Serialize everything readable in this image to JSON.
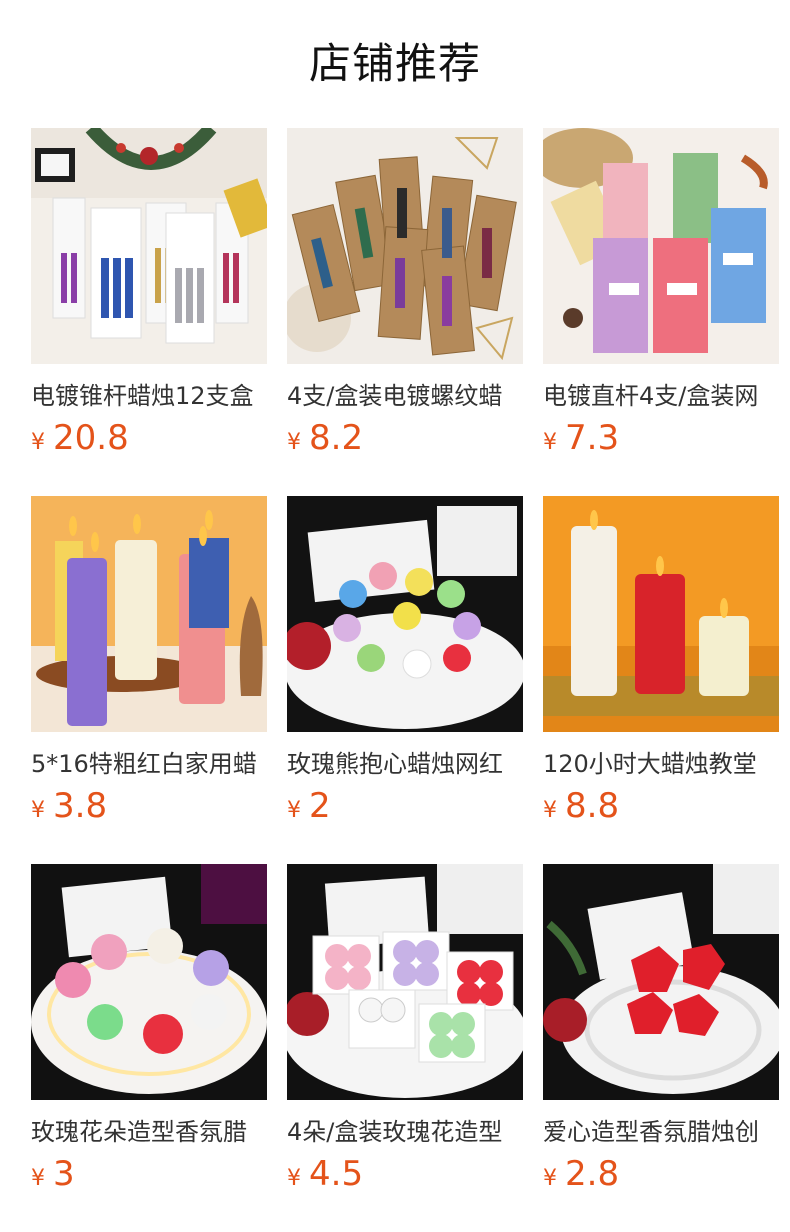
{
  "header": {
    "title": "店铺推荐"
  },
  "currency_symbol": "¥",
  "colors": {
    "price": "#e4531a",
    "text": "#333333"
  },
  "products": [
    {
      "name": "电镀锥杆蜡烛12支盒",
      "price": "20.8",
      "image": "gift-box-taper-candles"
    },
    {
      "name": "4支/盒装电镀螺纹蜡",
      "price": "8.2",
      "image": "kraft-box-spiral-candles"
    },
    {
      "name": "电镀直杆4支/盒装网",
      "price": "7.3",
      "image": "classic-pack-taper-candles"
    },
    {
      "name": "5*16特粗红白家用蜡",
      "price": "3.8",
      "image": "pillar-candles-colorful"
    },
    {
      "name": "玫瑰熊抱心蜡烛网红",
      "price": "2",
      "image": "teddy-bear-candles"
    },
    {
      "name": "120小时大蜡烛教堂",
      "price": "8.8",
      "image": "large-church-pillar-candles"
    },
    {
      "name": "玫瑰花朵造型香氛腊",
      "price": "3",
      "image": "rose-candles-tray"
    },
    {
      "name": "4朵/盒装玫瑰花造型",
      "price": "4.5",
      "image": "boxed-rose-candles"
    },
    {
      "name": "爱心造型香氛腊烛创",
      "price": "2.8",
      "image": "heart-candles-plate"
    }
  ]
}
